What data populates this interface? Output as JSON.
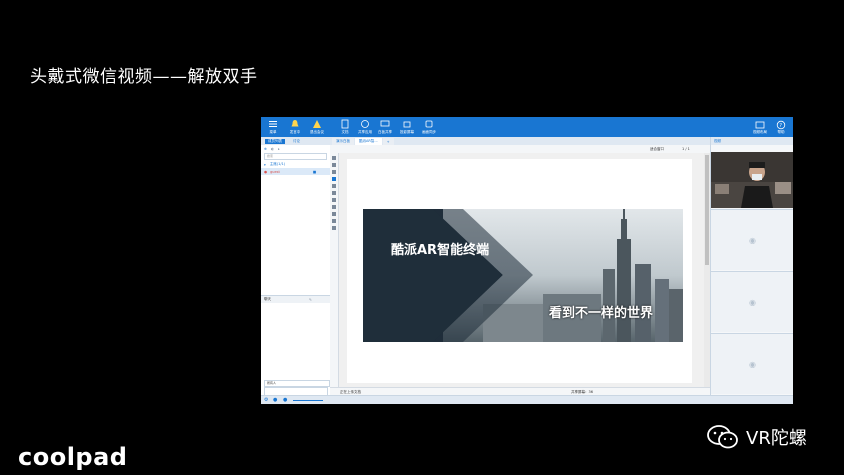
{
  "slide": {
    "title": "头戴式微信视频——解放双手",
    "brand": "coolpad",
    "wechat_account": "VR陀螺"
  },
  "app": {
    "toolbar": {
      "items": [
        "菜单",
        "发言中",
        "退出会议",
        "文档",
        "共享应用",
        "白板共享",
        "投影屏幕",
        "画面同步"
      ],
      "right_items": [
        "视频布局",
        "帮助"
      ]
    },
    "left_panel": {
      "tabs": [
        "成员列表",
        "讨论"
      ],
      "search_placeholder": "搜索",
      "group_label": "主席(1/1)",
      "user_name": "guest",
      "chat_label": "聊天",
      "chat_target": "所有人",
      "send_label": "发送"
    },
    "doc_tabs": [
      "演示白板",
      "酷派AR智..."
    ],
    "zoom": "适合窗口",
    "page_indicator": "1 / 1",
    "slide_content": {
      "line1": "酷派AR智能终端",
      "line2": "看到不一样的世界"
    },
    "status_left": "正在上传文档",
    "status_center": "共享屏幕：36",
    "video_panel_title": "视频"
  },
  "colors": {
    "accent": "#1976d2",
    "background": "#000000"
  }
}
